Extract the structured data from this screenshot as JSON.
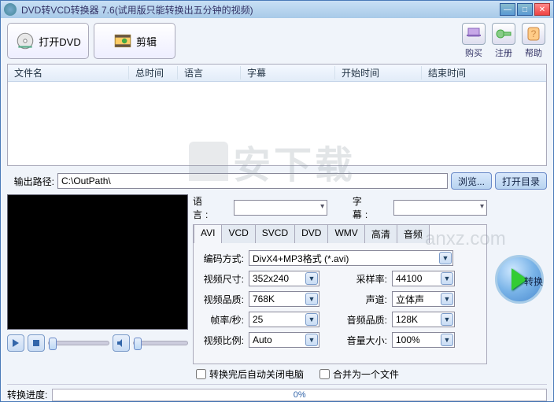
{
  "window": {
    "title": "DVD转VCD转换器 7.6(试用版只能转换出五分钟的视频)"
  },
  "toolbar": {
    "open_dvd": "打开DVD",
    "edit": "剪辑",
    "buy": "购买",
    "register": "注册",
    "help": "帮助"
  },
  "table": {
    "cols": [
      "文件名",
      "总时间",
      "语言",
      "字幕",
      "开始时间",
      "结束时间"
    ]
  },
  "path": {
    "label": "输出路径:",
    "value": "C:\\OutPath\\",
    "browse": "浏览...",
    "open_dir": "打开目录"
  },
  "langrow": {
    "lang_label": "语 言:",
    "sub_label": "字 幕:"
  },
  "tabs": [
    "AVI",
    "VCD",
    "SVCD",
    "DVD",
    "WMV",
    "高清",
    "音频"
  ],
  "form": {
    "enc_label": "编码方式:",
    "enc_value": "DivX4+MP3格式 (*.avi)",
    "size_label": "视频尺寸:",
    "size_value": "352x240",
    "sample_label": "采样率:",
    "sample_value": "44100",
    "vq_label": "视频品质:",
    "vq_value": "768K",
    "ch_label": "声道:",
    "ch_value": "立体声",
    "fps_label": "帧率/秒:",
    "fps_value": "25",
    "aq_label": "音频品质:",
    "aq_value": "128K",
    "ratio_label": "视频比例:",
    "ratio_value": "Auto",
    "vol_label": "音量大小:",
    "vol_value": "100%"
  },
  "convert": "转换",
  "checks": {
    "shutdown": "转换完后自动关闭电脑",
    "merge": "合并为一个文件"
  },
  "progress": {
    "label": "转换进度:",
    "value": "0%"
  },
  "watermark": "安下载",
  "watermark2": "anxz.com"
}
